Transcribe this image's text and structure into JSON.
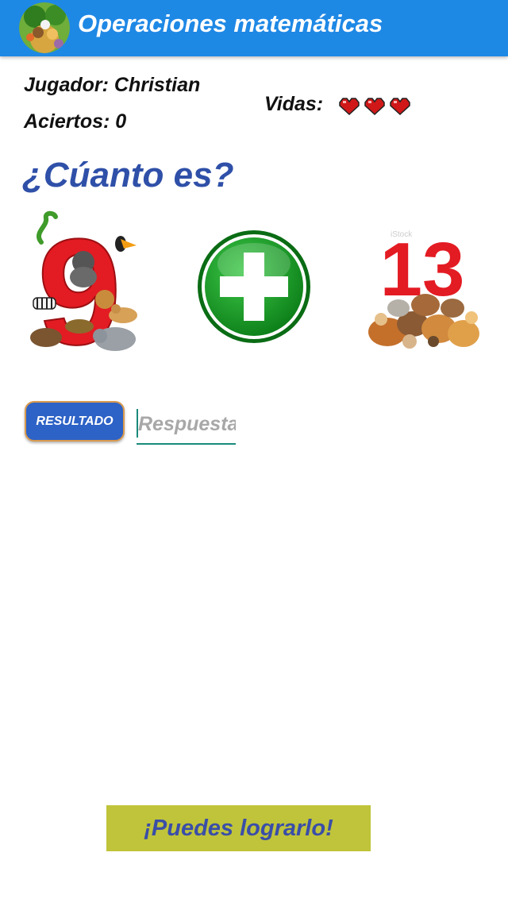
{
  "app": {
    "title": "Operaciones matemáticas",
    "logo_icon": "jungle-animals-logo-icon",
    "bar_color": "#1e88e5"
  },
  "player": {
    "label": "Jugador: Christian",
    "score_label": "Aciertos: 0",
    "lives_label": "Vidas:",
    "lives_count": 3,
    "life_icon": "heart-icon"
  },
  "question": {
    "prompt": "¿Cúanto es?",
    "operand1": "9",
    "operator": "+",
    "operator_icon": "plus-icon",
    "operand2": "13",
    "watermark": "iStock"
  },
  "answer": {
    "button_label": "RESULTADO",
    "placeholder": "Respuesta",
    "value": ""
  },
  "footer": {
    "message": "¡Puedes lograrlo!"
  }
}
